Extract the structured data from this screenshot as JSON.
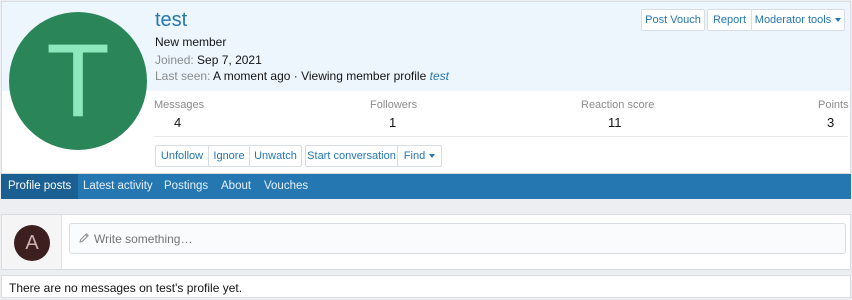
{
  "profile": {
    "avatar_letter": "T",
    "username": "test",
    "user_title": "New member",
    "joined_label": "Joined:",
    "joined_value": "Sep 7, 2021",
    "last_seen_label": "Last seen:",
    "last_seen_text": "A moment ago · Viewing member profile",
    "last_seen_link": "test"
  },
  "header_buttons": {
    "post_vouch": "Post Vouch",
    "report": "Report",
    "moderator_tools": "Moderator tools"
  },
  "stats": [
    {
      "label": "Messages",
      "value": "4"
    },
    {
      "label": "Followers",
      "value": "1"
    },
    {
      "label": "Reaction score",
      "value": "11"
    },
    {
      "label": "Points",
      "value": "3"
    }
  ],
  "action_buttons": {
    "unfollow": "Unfollow",
    "ignore": "Ignore",
    "unwatch": "Unwatch",
    "start_conversation": "Start conversation",
    "find": "Find"
  },
  "tabs": [
    {
      "label": "Profile posts",
      "active": true
    },
    {
      "label": "Latest activity"
    },
    {
      "label": "Postings"
    },
    {
      "label": "About"
    },
    {
      "label": "Vouches"
    }
  ],
  "composer": {
    "avatar_letter": "A",
    "placeholder": "Write something…"
  },
  "empty_message": "There are no messages on test's profile yet.",
  "colors": {
    "accent": "#2577b1",
    "avatar_big_bg": "#2a8659",
    "avatar_small_bg": "#3d1f1f",
    "header_bg": "#edf6fd"
  }
}
